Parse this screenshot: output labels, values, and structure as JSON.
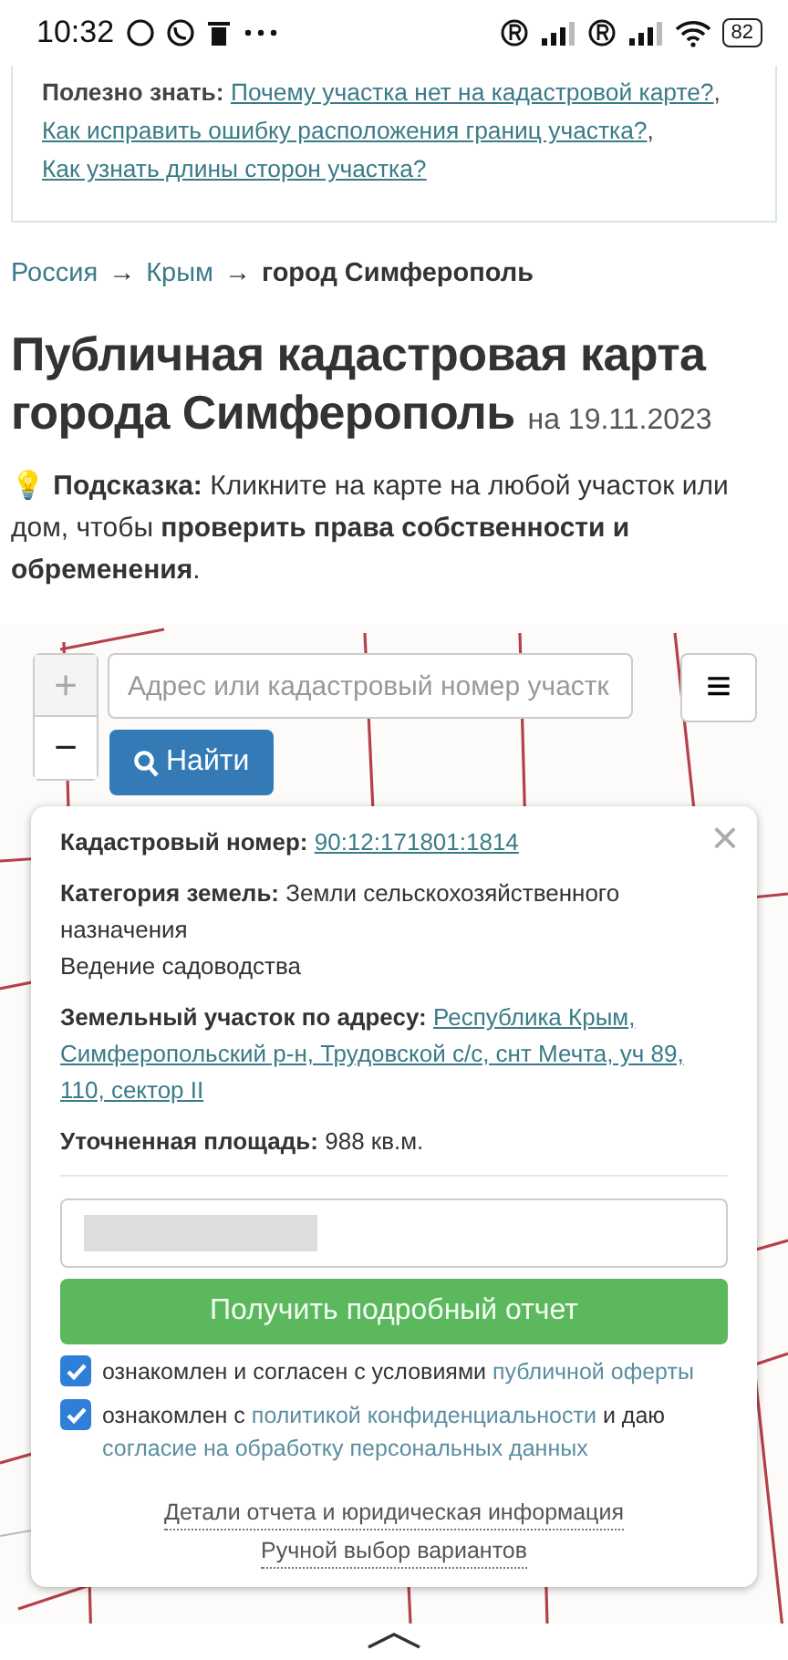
{
  "status_bar": {
    "time": "10:32",
    "battery": "82"
  },
  "info": {
    "label": "Полезно знать:",
    "links": [
      "Почему участка нет на кадастровой карте?",
      "Как исправить ошибку расположения границ участка?",
      "Как узнать длины сторон участка?"
    ],
    "separator": ","
  },
  "breadcrumbs": {
    "separator": "→",
    "items": [
      {
        "text": "Россия",
        "link": true
      },
      {
        "text": "Крым",
        "link": true
      },
      {
        "text": "город Симферополь",
        "link": false
      }
    ]
  },
  "title": "Публичная кадастровая карта города Симферополь",
  "title_date": "на 19.11.2023",
  "hint": {
    "icon": "💡",
    "text": "**Подсказка:** Кликните на карте на любой участок или дом, чтобы **проверить права собственности и обременения**."
  },
  "map": {
    "zoom_in": "+",
    "zoom_out": "−",
    "search_placeholder": "Адрес или кадастровый номер участк",
    "search_button": "Найти",
    "menu_button": "≡"
  },
  "popup": {
    "close": "×",
    "fields": [
      {
        "label": "Кадастровый номер:",
        "value": "90:12:171801:1814",
        "link": true
      },
      {
        "label": "Категория земель:",
        "value": "Земли сельскохозяйственного назначения",
        "link": false,
        "extra": "Ведение садоводства"
      },
      {
        "label": "Земельный участок по адресу:",
        "value": "Республика Крым, Симферопольский р-н, Трудовской с/с, снт Мечта, уч 89, 110, сектор II",
        "link": true
      },
      {
        "label": "Уточненная площадь:",
        "value": "988 кв.м.",
        "link": false
      }
    ],
    "report_button": "Получить подробный отчет",
    "consents": [
      {
        "checked": true,
        "parts": [
          {
            "text": "ознакомлен и согласен с условиями",
            "link": false
          },
          {
            "text": "публичной оферты",
            "link": true
          }
        ]
      },
      {
        "checked": true,
        "parts": [
          {
            "text": "ознакомлен с",
            "link": false
          },
          {
            "text": "политикой конфиденциальности",
            "link": true
          },
          {
            "text": "и даю",
            "link": false
          },
          {
            "text": "согласие на обработку персональных данных",
            "link": true
          }
        ]
      }
    ],
    "footer_links": [
      "Детали отчета и юридическая информация",
      "Ручной выбор вариантов"
    ]
  }
}
